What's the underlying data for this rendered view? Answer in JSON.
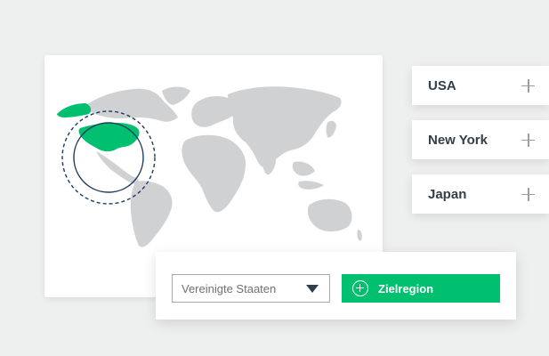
{
  "map": {
    "highlighted_region": "USA",
    "land_color": "#d0d1d2",
    "highlight_color": "#00bf6f",
    "ring_color": "#1e3a5f"
  },
  "regions": [
    {
      "label": "USA",
      "icon": "plus-icon"
    },
    {
      "label": "New York",
      "icon": "plus-icon"
    },
    {
      "label": "Japan",
      "icon": "plus-icon"
    }
  ],
  "action_panel": {
    "country_select": {
      "value": "Vereinigte Staaten",
      "icon": "chevron-down-icon"
    },
    "add_button": {
      "label": "Zielregion",
      "icon": "plus-circle-icon"
    }
  },
  "colors": {
    "accent": "#00bf6f",
    "text_dark": "#333e48",
    "background": "#eeefef"
  }
}
